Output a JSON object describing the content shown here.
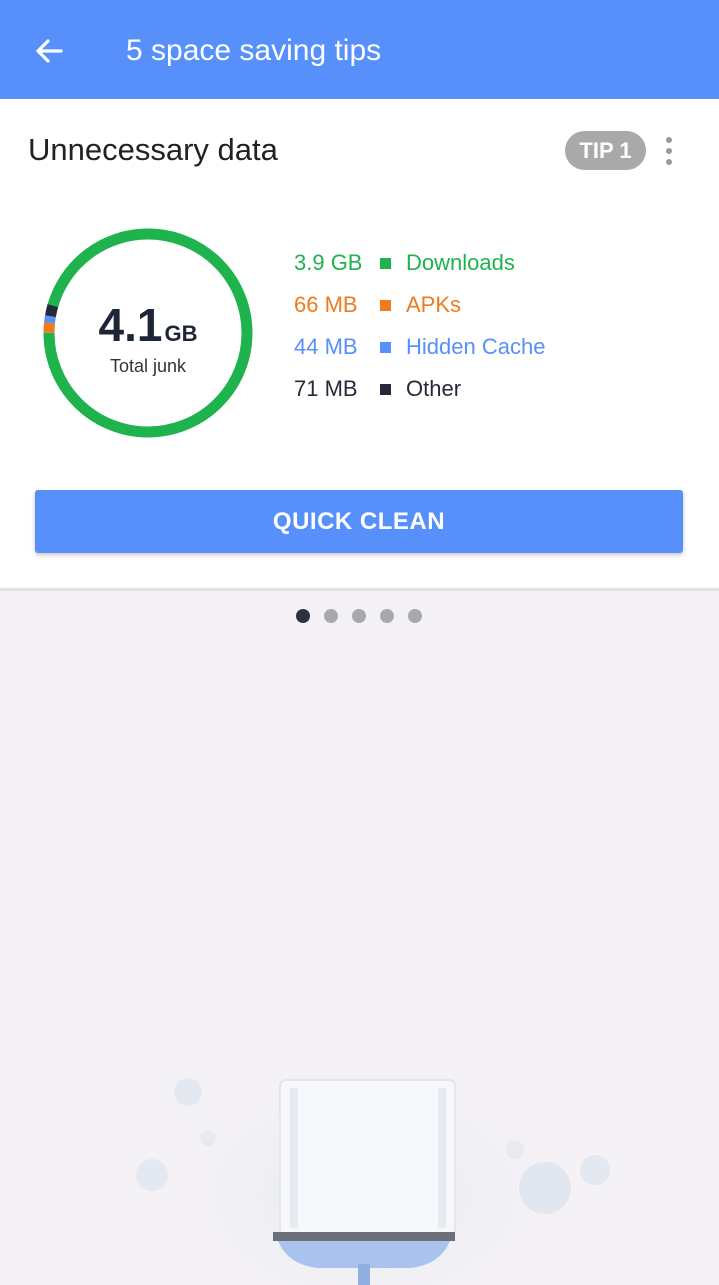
{
  "header": {
    "title": "5 space saving tips",
    "back_icon": "arrow-back-icon"
  },
  "card": {
    "title": "Unnecessary data",
    "tip_badge": "TIP 1",
    "menu_icon": "more-vert-icon",
    "total": {
      "value": "4.1",
      "unit": "GB",
      "label": "Total junk"
    },
    "breakdown": [
      {
        "value": "3.9 GB",
        "name": "Downloads",
        "color": "#1fb34d"
      },
      {
        "value": "66 MB",
        "name": "APKs",
        "color": "#f07a1c"
      },
      {
        "value": "44 MB",
        "name": "Hidden Cache",
        "color": "#5790fb"
      },
      {
        "value": "71 MB",
        "name": "Other",
        "color": "#25293a"
      }
    ],
    "button_label": "QUICK CLEAN"
  },
  "pager": {
    "count": 5,
    "active": 0
  },
  "illustration": {
    "icon": "broom-illustration"
  },
  "colors": {
    "accent": "#5790fb",
    "background": "#f5f2f5"
  }
}
